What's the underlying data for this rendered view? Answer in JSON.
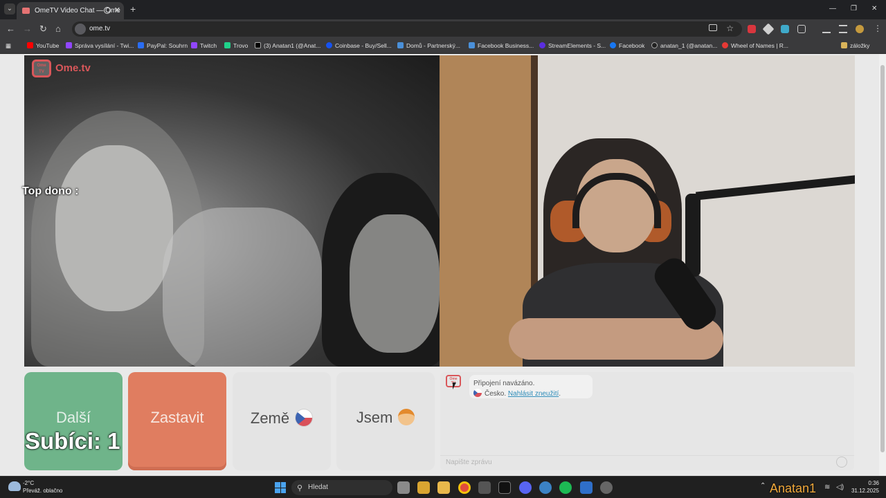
{
  "browser": {
    "tab_title": "OmeTV Video Chat — Ome",
    "url": "ome.tv",
    "bookmarks": [
      {
        "label": "YouTube",
        "color": "#ff0000"
      },
      {
        "label": "Správa vysílání - Twi...",
        "color": "#9146ff"
      },
      {
        "label": "PayPal: Souhrn",
        "color": "#2a6df4"
      },
      {
        "label": "Twitch",
        "color": "#9146ff"
      },
      {
        "label": "Trovo",
        "color": "#1fd18a"
      },
      {
        "label": "(3) Anatan1 (@Anat...",
        "color": "#000000"
      },
      {
        "label": "Coinbase - Buy/Sell...",
        "color": "#1652f0"
      },
      {
        "label": "Domů - Partnerský...",
        "color": "#4a90d9"
      },
      {
        "label": "Facebook Business...",
        "color": "#4a90d9"
      },
      {
        "label": "StreamElements - S...",
        "color": "#5b2ee0"
      },
      {
        "label": "Facebook",
        "color": "#1877f2"
      },
      {
        "label": "anatan_1 (@anatan...",
        "color": "#222222"
      },
      {
        "label": "Wheel of Names | R...",
        "color": "#e53935"
      }
    ],
    "other_bookmarks": "záložky"
  },
  "page": {
    "logo_small": "Ome TV",
    "logo_text": "Ome.tv",
    "overlay_top_dono": "Top dono :",
    "overlay_subs": "Subíci: 1",
    "buttons": {
      "next": "Další",
      "stop": "Zastavit",
      "country": "Země",
      "gender": "Jsem"
    },
    "chat": {
      "status": "Připojení navázáno.",
      "country": "Česko.",
      "report_link": "Nahlásit zneužití",
      "report_suffix": ".",
      "placeholder": "Napište zprávu"
    }
  },
  "taskbar": {
    "temperature": "-2°C",
    "weather": "Převáž. oblačno",
    "search_label": "Hledat",
    "time": "0:36",
    "date": "31.12.2025",
    "watermark": "Anatan1"
  }
}
